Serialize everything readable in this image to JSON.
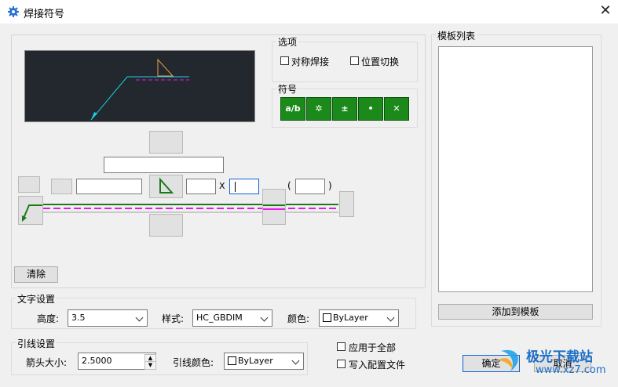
{
  "window": {
    "title": "焊接符号",
    "close": "✕"
  },
  "options": {
    "legend": "选项",
    "symmetric": "对称焊接",
    "position_switch": "位置切换"
  },
  "symbols": {
    "legend": "符号",
    "items": [
      "a/b",
      "✲",
      "±",
      "•",
      "✕"
    ]
  },
  "weld": {
    "x_sep": "X",
    "paren_open": "(",
    "paren_close": ")"
  },
  "clear_button": "清除",
  "text_settings": {
    "legend": "文字设置",
    "height_label": "高度:",
    "height_value": "3.5",
    "style_label": "样式:",
    "style_value": "HC_GBDIM",
    "color_label": "颜色:",
    "color_value": "ByLayer"
  },
  "leader_settings": {
    "legend": "引线设置",
    "arrow_size_label": "箭头大小:",
    "arrow_size_value": "2.5000",
    "leader_color_label": "引线颜色:",
    "leader_color_value": "ByLayer"
  },
  "apply_all": "应用于全部",
  "write_config": "写入配置文件",
  "template": {
    "legend": "模板列表",
    "add_button": "添加到模板"
  },
  "ok_button": "确定",
  "cancel_button": "取消",
  "watermark": {
    "brand": "极光下载站",
    "url": "www.xz7.com"
  },
  "colors": {
    "preview_bg": "#23272e",
    "symbol_green": "#1b8a1b",
    "magenta": "#e619e6"
  }
}
